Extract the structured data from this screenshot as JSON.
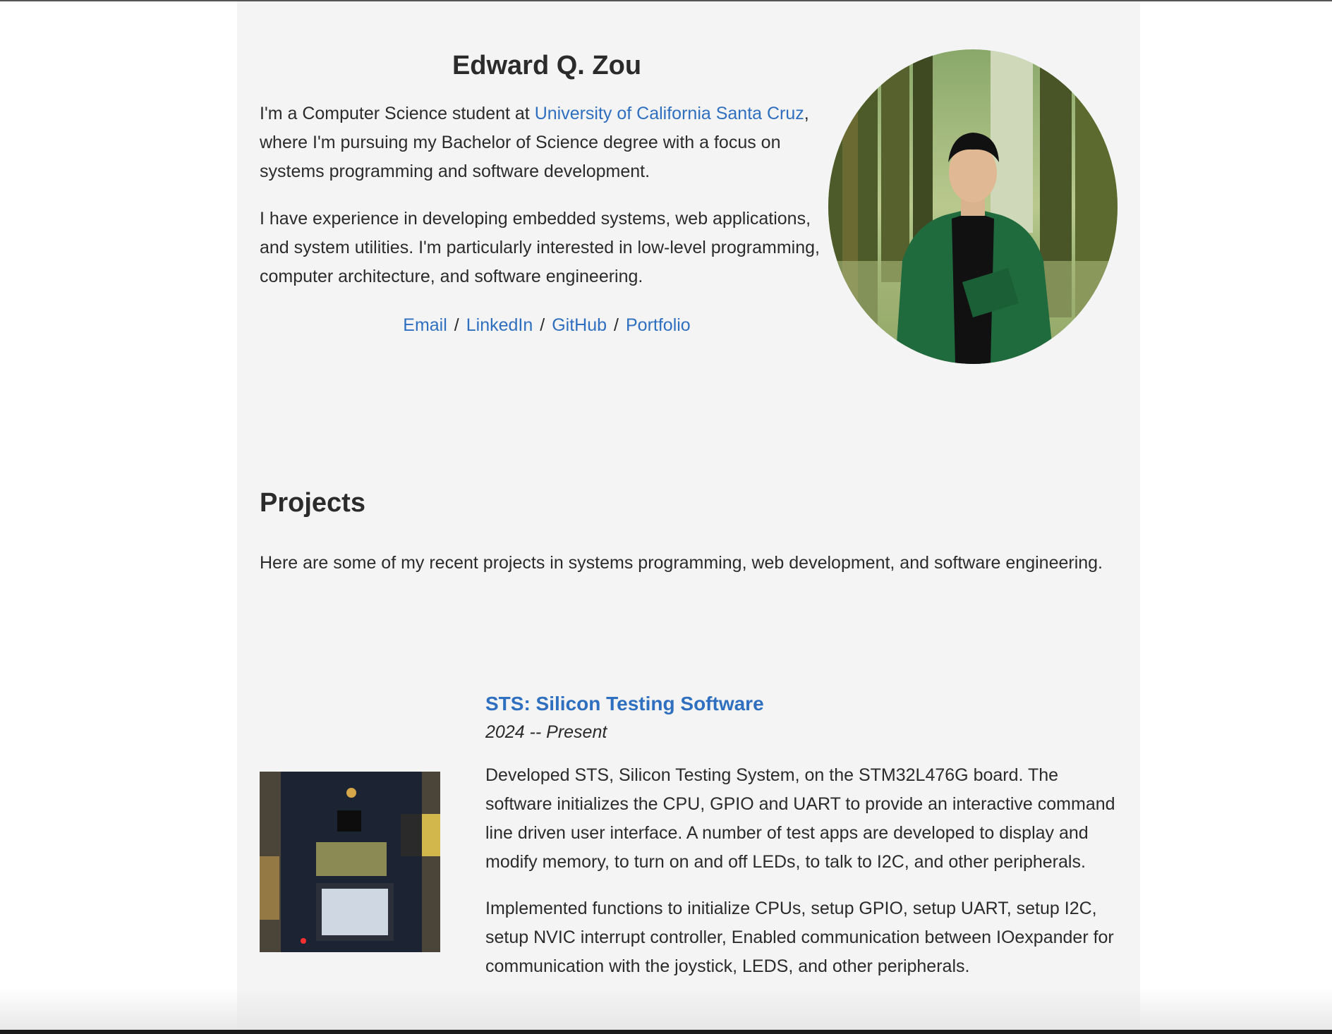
{
  "header": {
    "name": "Edward Q. Zou"
  },
  "intro": {
    "p1_before": "I'm a Computer Science student at ",
    "p1_link": "University of California Santa Cruz",
    "p1_after": ", where I'm pursuing my Bachelor of Science degree with a focus on systems programming and software development.",
    "p2": "I have experience in developing embedded systems, web applications, and system utilities. I'm particularly interested in low-level programming, computer architecture, and software engineering."
  },
  "links": [
    {
      "label": "Email",
      "icon": ""
    },
    {
      "label": "LinkedIn",
      "icon": ""
    },
    {
      "label": "GitHub",
      "icon": ""
    },
    {
      "label": "Portfolio",
      "icon": ""
    }
  ],
  "link_separator": "/",
  "projects": {
    "title": "Projects",
    "intro": "Here are some of my recent projects in systems programming, web development, and software engineering.",
    "items": [
      {
        "title": "STS: Silicon Testing Software",
        "date": "2024 -- Present",
        "p1": "Developed STS, Silicon Testing System, on the STM32L476G board. The software initializes the CPU, GPIO and UART to provide an interactive command line driven user interface. A number of test apps are developed to display and modify memory, to turn on and off LEDs, to talk to I2C, and other peripherals.",
        "p2": "Implemented functions to initialize CPUs, setup GPIO, setup UART, setup I2C, setup NVIC interrupt controller, Enabled communication between IOexpander for communication with the joystick, LEDS, and other peripherals."
      }
    ]
  },
  "colors": {
    "link": "#2f6fbf",
    "page_bg": "#f4f4f4",
    "text": "#2b2b2b"
  }
}
